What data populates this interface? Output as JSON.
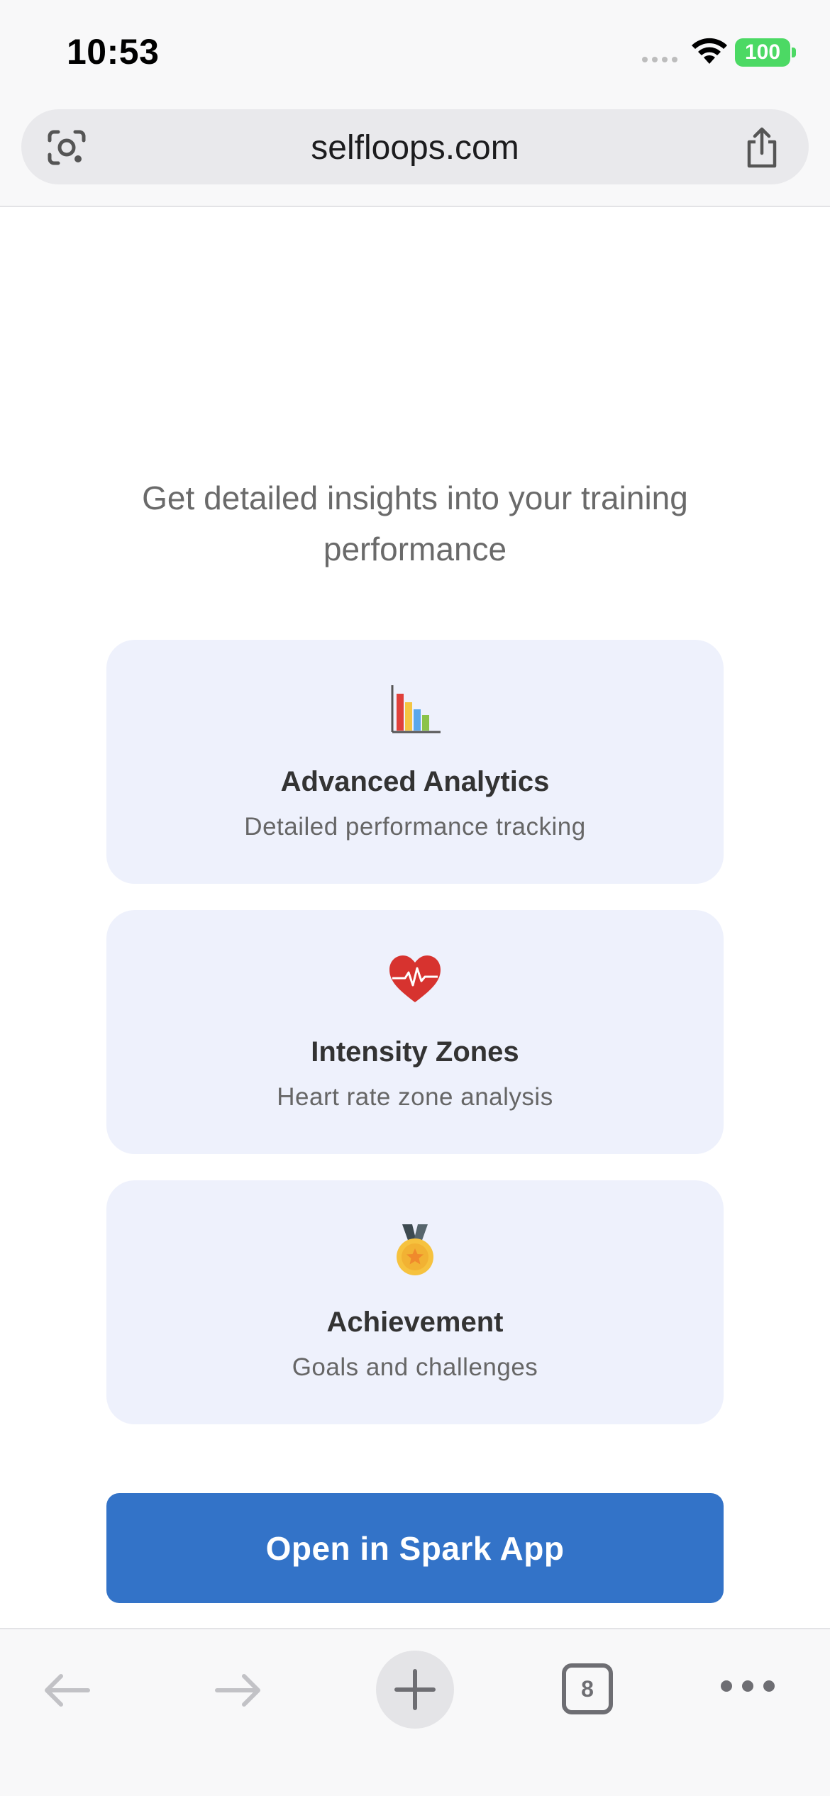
{
  "status_bar": {
    "time": "10:53",
    "battery": "100"
  },
  "browser": {
    "url": "selfloops.com",
    "icons": [
      "lens-icon",
      "share-icon"
    ]
  },
  "page": {
    "tagline": "Get detailed insights into your training performance",
    "features": [
      {
        "icon": "bar-chart-icon",
        "title": "Advanced Analytics",
        "subtitle": "Detailed performance tracking"
      },
      {
        "icon": "heart-pulse-icon",
        "title": "Intensity Zones",
        "subtitle": "Heart rate zone analysis"
      },
      {
        "icon": "medal-icon",
        "title": "Achievement",
        "subtitle": "Goals and challenges"
      }
    ],
    "cta_label": "Open in Spark App",
    "cta_color": "#3373c8"
  },
  "toolbar": {
    "tab_count": "8",
    "icons": [
      "back-arrow-icon",
      "forward-arrow-icon",
      "plus-icon",
      "tabs-icon",
      "more-icon"
    ]
  }
}
